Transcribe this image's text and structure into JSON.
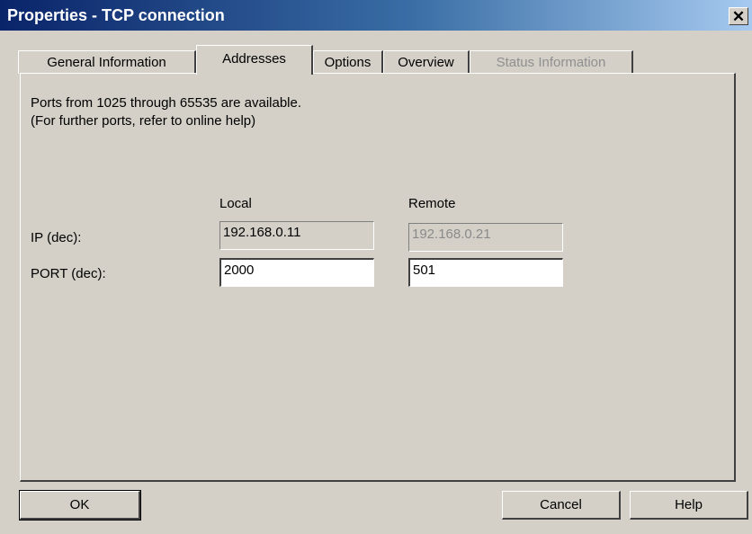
{
  "window": {
    "title": "Properties - TCP connection",
    "close_glyph": "✕"
  },
  "tabs": [
    {
      "label": "General Information",
      "state": "normal"
    },
    {
      "label": "Addresses",
      "state": "active"
    },
    {
      "label": "Options",
      "state": "normal"
    },
    {
      "label": "Overview",
      "state": "normal"
    },
    {
      "label": "Status Information",
      "state": "disabled"
    }
  ],
  "info": {
    "line1": "Ports from 1025 through 65535 are available.",
    "line2": "(For further ports, refer to online help)"
  },
  "columns": {
    "local": "Local",
    "remote": "Remote"
  },
  "rows": {
    "ip": {
      "label": "IP (dec):",
      "local": "192.168.0.11",
      "remote": "192.168.0.21"
    },
    "port": {
      "label": "PORT (dec):",
      "local": "2000",
      "remote": "501"
    }
  },
  "buttons": {
    "ok": "OK",
    "cancel": "Cancel",
    "help": "Help"
  }
}
